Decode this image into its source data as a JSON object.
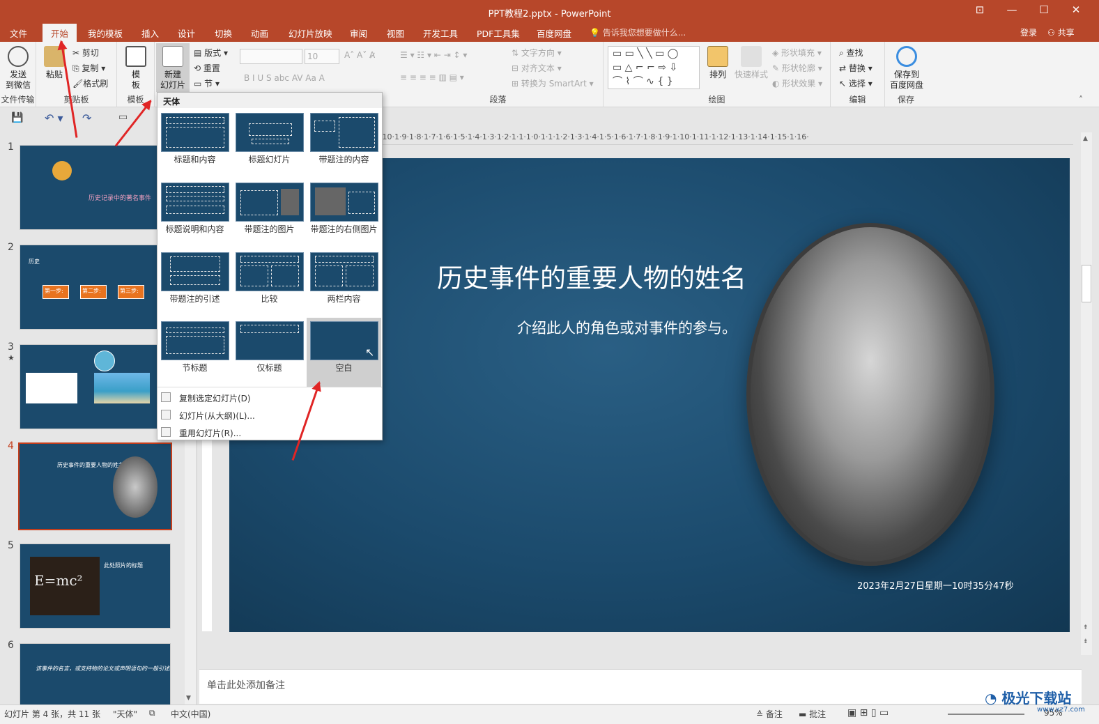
{
  "window": {
    "title": "PPT教程2.pptx - PowerPoint",
    "controls": [
      "⊡",
      "—",
      "☐",
      "✕"
    ]
  },
  "tabs": [
    {
      "label": "文件",
      "active": false
    },
    {
      "label": "开始",
      "active": true
    },
    {
      "label": "我的模板",
      "active": false
    },
    {
      "label": "插入",
      "active": false
    },
    {
      "label": "设计",
      "active": false
    },
    {
      "label": "切换",
      "active": false
    },
    {
      "label": "动画",
      "active": false
    },
    {
      "label": "幻灯片放映",
      "active": false
    },
    {
      "label": "审阅",
      "active": false
    },
    {
      "label": "视图",
      "active": false
    },
    {
      "label": "开发工具",
      "active": false
    },
    {
      "label": "PDF工具集",
      "active": false
    },
    {
      "label": "百度网盘",
      "active": false
    }
  ],
  "tellme": "告诉我您想要做什么...",
  "login": "登录",
  "share": "共享",
  "ribbon": {
    "send": {
      "label": "发送\n到微信",
      "group": "文件传输"
    },
    "paste": {
      "label": "粘贴"
    },
    "cut": "剪切",
    "copy": "复制",
    "format_painter": "格式刷",
    "clipboard_group": "剪贴板",
    "template": {
      "label": "模\n板",
      "group": "模板"
    },
    "new_slide": {
      "label": "新建\n幻灯片"
    },
    "layout": "版式",
    "reset": "重置",
    "section": "节",
    "font_size": "10",
    "text_direction": "文字方向",
    "align_text": "对齐文本",
    "convert_smartart": "转换为 SmartArt",
    "paragraph_group": "段落",
    "arrange": "排列",
    "quick_styles": "快速样式",
    "shape_fill": "形状填充",
    "shape_outline": "形状轮廓",
    "shape_effects": "形状效果",
    "drawing_group": "绘图",
    "find": "查找",
    "replace": "替换",
    "select": "选择",
    "editing_group": "编辑",
    "save_baidu": "保存到\n百度网盘",
    "save_group": "保存"
  },
  "slides": [
    {
      "num": "1",
      "title": "历史记录中的著名事件"
    },
    {
      "num": "2",
      "title": "历史",
      "steps": [
        "第一步:",
        "第二步:",
        "第三步:"
      ]
    },
    {
      "num": "3",
      "star": "★"
    },
    {
      "num": "4",
      "title": "历史事件的重要人物的姓名"
    },
    {
      "num": "5",
      "title": "此处照片的标题",
      "formula": "E=mc²"
    },
    {
      "num": "6",
      "title": "该事件的名言，或支持物的论文或声明语句的一般引述。"
    }
  ],
  "slide": {
    "title": "历史事件的重要人物的姓名",
    "subtitle": "介绍此人的角色或对事件的参与。",
    "date": "2023年2月27日星期一10时35分47秒"
  },
  "ruler": "·10·1·9·1·8·1·7·1·6·1·5·1·4·1·3·1·2·1·1·1·0·1·1·1·2·1·3·1·4·1·5·1·6·1·7·1·8·1·9·1·10·1·11·1·12·1·13·1·14·1·15·1·16·",
  "dropdown": {
    "header": "天体",
    "layouts": [
      "标题和内容",
      "标题幻灯片",
      "带题注的内容",
      "标题说明和内容",
      "带题注的图片",
      "带题注的右侧图片",
      "带题注的引述",
      "比较",
      "两栏内容",
      "节标题",
      "仅标题",
      "空白"
    ],
    "selected": "空白",
    "items": [
      "复制选定幻灯片(D)",
      "幻灯片(从大纲)(L)...",
      "重用幻灯片(R)..."
    ]
  },
  "notes": "单击此处添加备注",
  "status": {
    "slide_info": "幻灯片 第 4 张，共 11 张",
    "theme": "\"天体\"",
    "lang": "中文(中国)",
    "notes_btn": "备注",
    "comments_btn": "批注",
    "zoom": "95%"
  },
  "watermark": {
    "text": "极光下载站",
    "url": "www.xz7.com"
  }
}
